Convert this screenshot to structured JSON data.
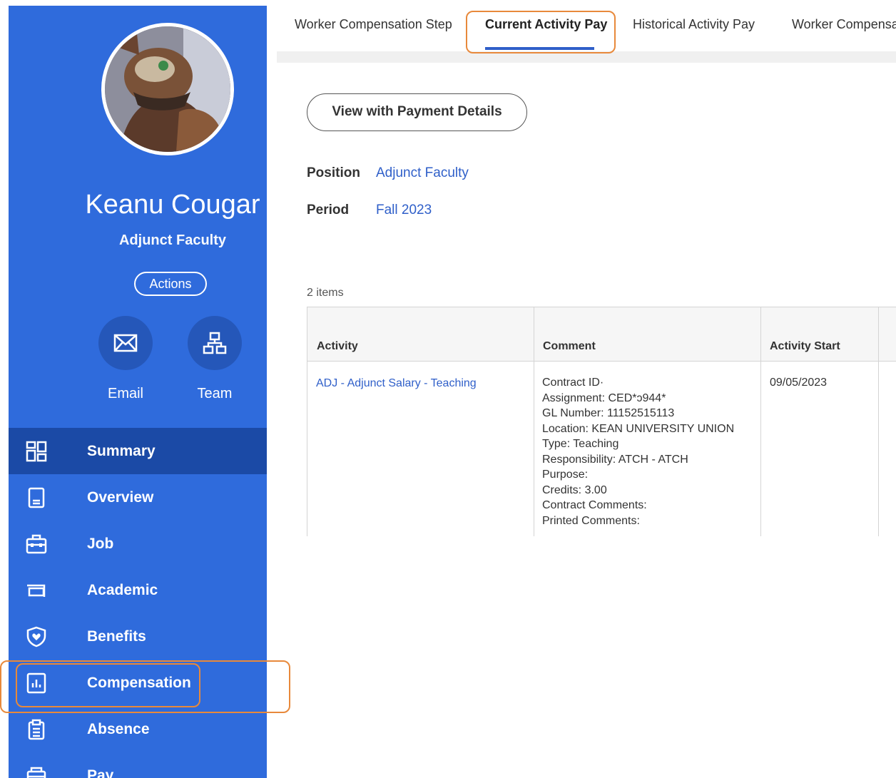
{
  "profile": {
    "name": "Keanu Cougar",
    "title": "Adjunct Faculty",
    "actions_label": "Actions",
    "quick_actions": [
      {
        "label": "Email",
        "icon": "envelope-icon"
      },
      {
        "label": "Team",
        "icon": "org-chart-icon"
      }
    ]
  },
  "nav": {
    "items": [
      {
        "label": "Summary",
        "icon": "grid-icon"
      },
      {
        "label": "Overview",
        "icon": "document-icon"
      },
      {
        "label": "Job",
        "icon": "briefcase-icon"
      },
      {
        "label": "Academic",
        "icon": "mortarboard-icon"
      },
      {
        "label": "Benefits",
        "icon": "shield-heart-icon"
      },
      {
        "label": "Compensation",
        "icon": "bar-chart-icon"
      },
      {
        "label": "Absence",
        "icon": "clipboard-icon"
      },
      {
        "label": "Pay",
        "icon": "wallet-icon"
      }
    ],
    "active": "Summary"
  },
  "tabs": [
    {
      "label": "Worker Compensation Step"
    },
    {
      "label": "Current Activity Pay"
    },
    {
      "label": "Historical Activity Pay"
    },
    {
      "label": "Worker Compensa"
    }
  ],
  "main": {
    "view_button": "View with Payment Details",
    "position_label": "Position",
    "position_value": "Adjunct Faculty",
    "period_label": "Period",
    "period_value": "Fall 2023",
    "items_count": "2 items",
    "table": {
      "headers": [
        "Activity",
        "Comment",
        "Activity Start"
      ],
      "rows": [
        {
          "activity": "ADJ - Adjunct Salary - Teaching",
          "comment": [
            "Contract ID·",
            "Assignment: CED*ɔ944*",
            "GL Number: 11152515113",
            "Location: KEAN UNIVERSITY UNION",
            "Type: Teaching",
            "Responsibility: ATCH - ATCH",
            "Purpose:",
            "Credits: 3.00",
            "Contract Comments:",
            "Printed Comments:"
          ],
          "activity_start": "09/05/2023"
        }
      ]
    }
  },
  "colors": {
    "sidebar": "#2f6bdc",
    "sidebar_active": "#1b4aa6",
    "link": "#2f5fc9",
    "highlight": "#e8893b"
  }
}
